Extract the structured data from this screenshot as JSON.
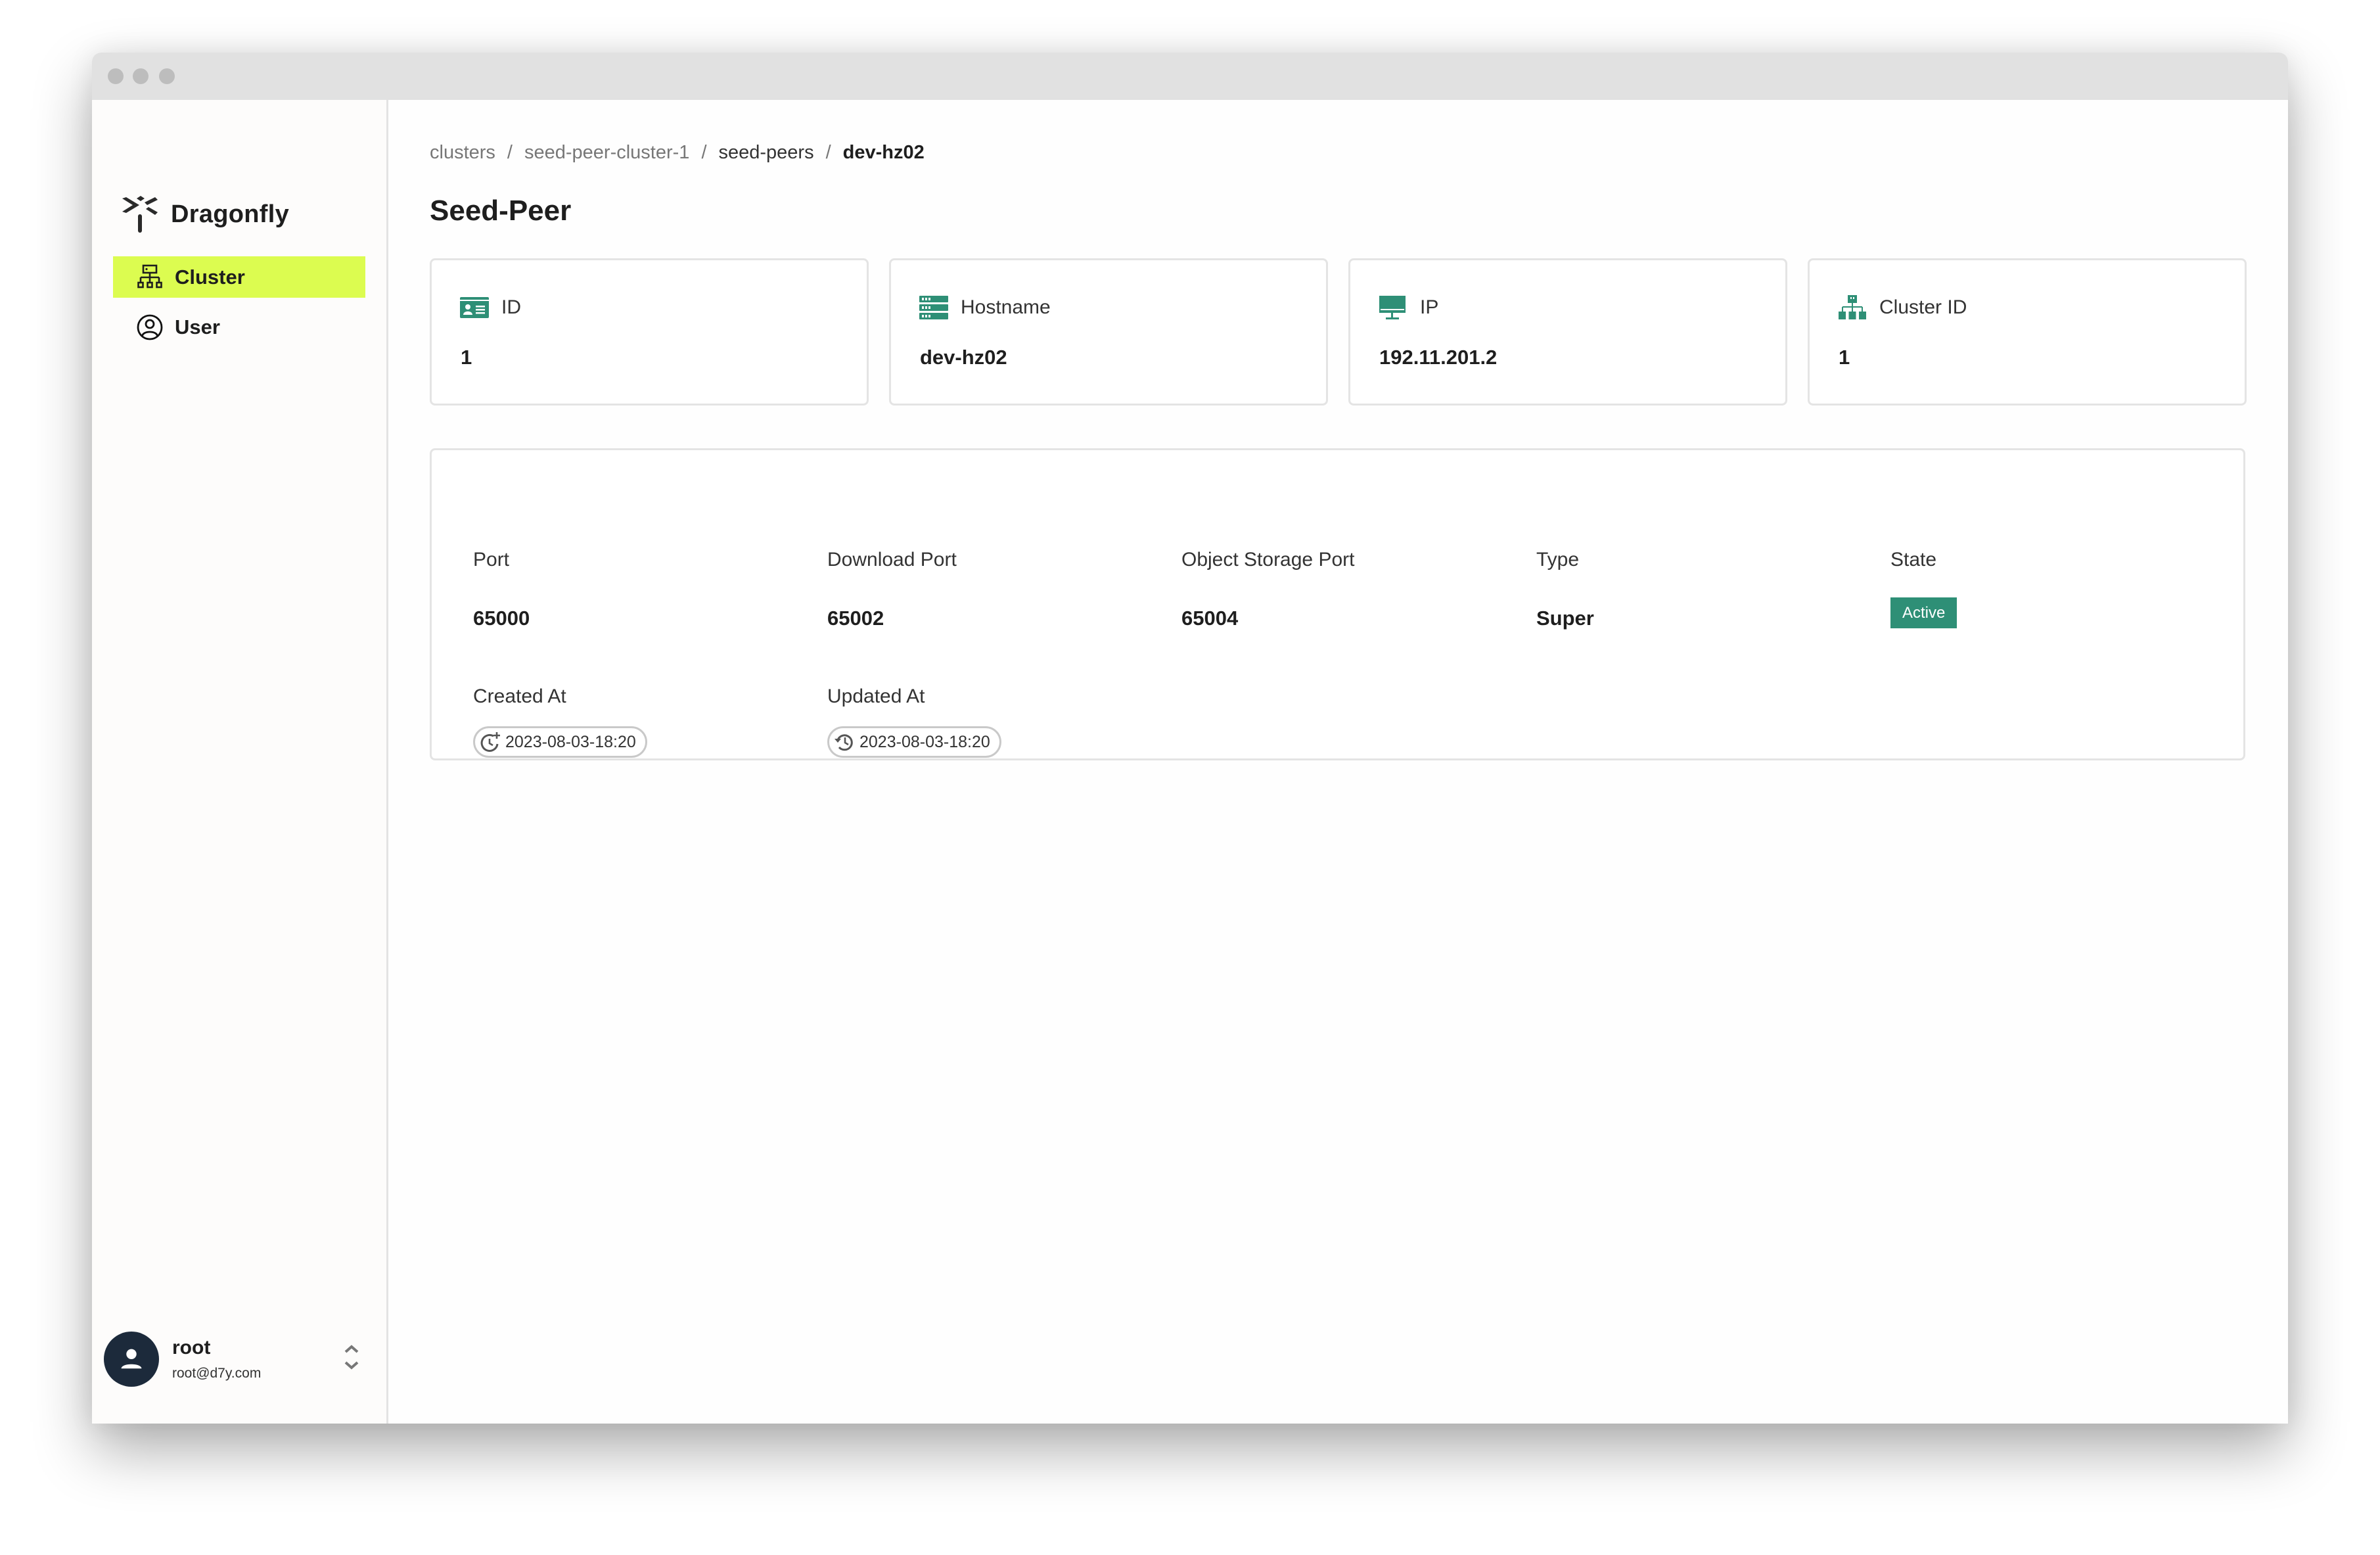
{
  "window": {
    "controls": [
      "close",
      "minimize",
      "maximize"
    ]
  },
  "sidebar": {
    "brand": "Dragonfly",
    "items": [
      {
        "label": "Cluster",
        "icon": "cluster-icon",
        "active": true
      },
      {
        "label": "User",
        "icon": "user-circle-icon",
        "active": false
      }
    ],
    "user": {
      "name": "root",
      "email": "root@d7y.com"
    }
  },
  "breadcrumb": [
    "clusters",
    "seed-peer-cluster-1",
    "seed-peers",
    "dev-hz02"
  ],
  "page": {
    "title": "Seed-Peer"
  },
  "info_cards": [
    {
      "label": "ID",
      "value": "1",
      "icon": "id-card-icon"
    },
    {
      "label": "Hostname",
      "value": "dev-hz02",
      "icon": "server-icon"
    },
    {
      "label": "IP",
      "value": "192.11.201.2",
      "icon": "monitor-icon"
    },
    {
      "label": "Cluster ID",
      "value": "1",
      "icon": "cluster-tree-icon"
    }
  ],
  "details": {
    "port": {
      "label": "Port",
      "value": "65000"
    },
    "download_port": {
      "label": "Download Port",
      "value": "65002"
    },
    "object_storage_port": {
      "label": "Object Storage Port",
      "value": "65004"
    },
    "type": {
      "label": "Type",
      "value": "Super"
    },
    "state": {
      "label": "State",
      "value": "Active",
      "color": "#2e8f76"
    },
    "created_at": {
      "label": "Created At",
      "value": "2023-08-03-18:20"
    },
    "updated_at": {
      "label": "Updated At",
      "value": "2023-08-03-18:20"
    }
  },
  "colors": {
    "accent": "#2e8f76",
    "nav_active": "#dcfc50",
    "avatar": "#1c2a3b"
  }
}
